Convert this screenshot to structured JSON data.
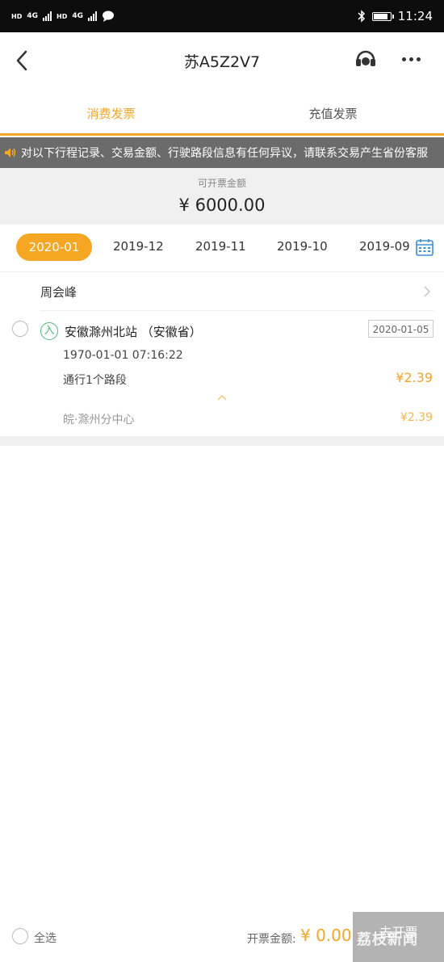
{
  "status_bar": {
    "hd_label": "HD",
    "net_label": "4G",
    "time": "11:24",
    "icons": [
      "signal-icon",
      "message-icon",
      "bluetooth-icon",
      "battery-icon"
    ],
    "battery_level": 0.9
  },
  "header": {
    "title": "苏A5Z2V7",
    "icons": [
      "back-icon",
      "headset-icon",
      "more-icon"
    ]
  },
  "tabs": [
    {
      "label": "消费发票",
      "active": true
    },
    {
      "label": "充值发票",
      "active": false
    }
  ],
  "notice": {
    "text": "对以下行程记录、交易金额、行驶路段信息有任何异议，请联系交易产生省份客服"
  },
  "summary": {
    "label": "可开票金额",
    "amount": "¥ 6000.00"
  },
  "months": {
    "items": [
      "2020-01",
      "2019-12",
      "2019-11",
      "2019-10",
      "2019-09"
    ],
    "selected": "2020-01"
  },
  "group": {
    "owner": "周会峰",
    "trip": {
      "entry_mark": "入",
      "station": "安徽滁州北站 （安徽省）",
      "date": "2020-01-05",
      "timestamp": "1970-01-01 07:16:22",
      "segments_label": "通行1个路段",
      "segments_price": "¥2.39",
      "center_name": "皖·滁州分中心",
      "center_price": "¥2.39"
    }
  },
  "footer": {
    "select_all": "全选",
    "invoice_label": "开票金额:",
    "invoice_amount": "¥ 0.00",
    "go_button": "去开票",
    "watermark": "荔枝新闻"
  },
  "colors": {
    "accent": "#f5a623",
    "entry_green": "#4cb87a",
    "notice_bg": "#6b6b6b",
    "button_disabled": "#b3b3b3"
  }
}
